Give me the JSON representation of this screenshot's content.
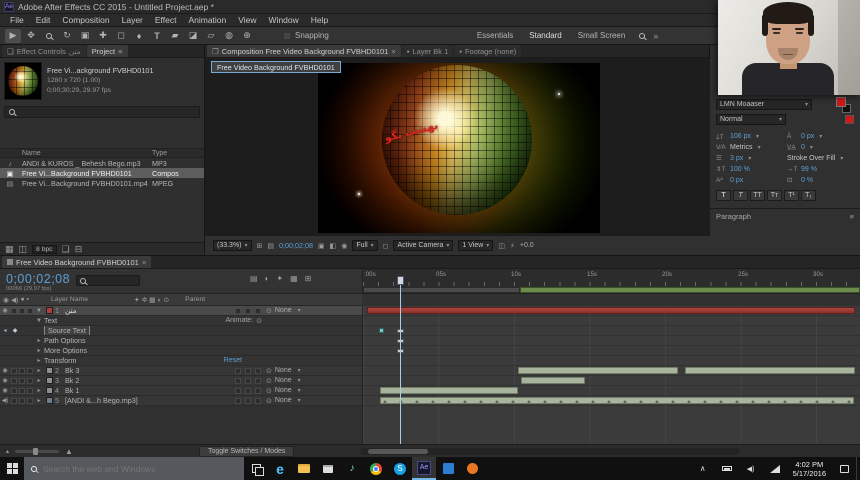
{
  "titlebar": {
    "title": "Adobe After Effects CC 2015 - Untitled Project.aep *"
  },
  "menubar": {
    "items": [
      "File",
      "Edit",
      "Composition",
      "Layer",
      "Effect",
      "Animation",
      "View",
      "Window",
      "Help"
    ]
  },
  "toolbar": {
    "snapping": "Snapping",
    "workspaces": [
      "Essentials",
      "Standard",
      "Small Screen"
    ]
  },
  "project": {
    "effect_controls_tab": "Effect Controls",
    "effect_controls_layer": "متن",
    "project_tab": "Project",
    "preview_title": "Free Vi...ackground FVBHD0101",
    "preview_info1": "1280 x 720 (1.00)",
    "preview_info2": "0;00;30;29, 29.97 fps",
    "col_name": "Name",
    "col_type": "Type",
    "files": [
      {
        "name": "ANDI & KUROS _ Behesh Bego.mp3",
        "type": "MP3"
      },
      {
        "name": "Free Vi...Background FVBHD0101",
        "type": "Compos"
      },
      {
        "name": "Free Vi...Background FVBHD0101.mp4",
        "type": "MPEG"
      }
    ],
    "bpc": "8 bpc"
  },
  "comp": {
    "tab_composition": "Composition Free Video Background FVBHD0101",
    "tab_layer": "Layer Bk 1",
    "tab_footage": "Footage (none)",
    "tooltip": "Free Video Background FVBHD0101",
    "watermark": "بهشت بگو",
    "zoom": "(33.3%)",
    "timecode": "0;00;02;08",
    "resolution": "Full",
    "camera": "Active Camera",
    "view": "1 View",
    "exposure": "+0.0"
  },
  "character": {
    "font": "LMN Moaaser",
    "mode": "Normal",
    "size": "106 px",
    "leading": "0 px",
    "kerning": "Metrics",
    "tracking": "0",
    "stroke_width": "3 px",
    "stroke_style": "Stroke Over Fill",
    "v_scale": "100 %",
    "h_scale": "99 %",
    "baseline": "0 px",
    "tsume": "0 %",
    "styles": [
      "T",
      "T",
      "TT",
      "Tᴛ",
      "T¹",
      "T₁"
    ],
    "paragraph": "Paragraph"
  },
  "timeline": {
    "tab": "Free Video Background FVBHD0101",
    "timecode": "0;00;02;08",
    "frames": "00066 (29.97 fps)",
    "ruler": [
      ":00s",
      "05s",
      "10s",
      "15s",
      "20s",
      "25s",
      "30s"
    ],
    "col_layer": "Layer Name",
    "col_parent": "Parent",
    "animate": "Animate:",
    "reset": "Reset",
    "props": [
      "Text",
      "Source Text",
      "Path Options",
      "More Options",
      "Transform"
    ],
    "layers": [
      {
        "num": "1",
        "name": "متن",
        "parent": "None"
      },
      {
        "num": "2",
        "name": "Bk 3",
        "parent": "None"
      },
      {
        "num": "3",
        "name": "Bk 2",
        "parent": "None"
      },
      {
        "num": "4",
        "name": "Bk 1",
        "parent": "None"
      },
      {
        "num": "5",
        "name": "[ANDI &...h Bego.mp3]",
        "parent": "None"
      }
    ],
    "footer": "Toggle Switches / Modes"
  },
  "taskbar": {
    "search": "Search the web and Windows",
    "time": "4:02 PM",
    "date": "5/17/2016"
  }
}
